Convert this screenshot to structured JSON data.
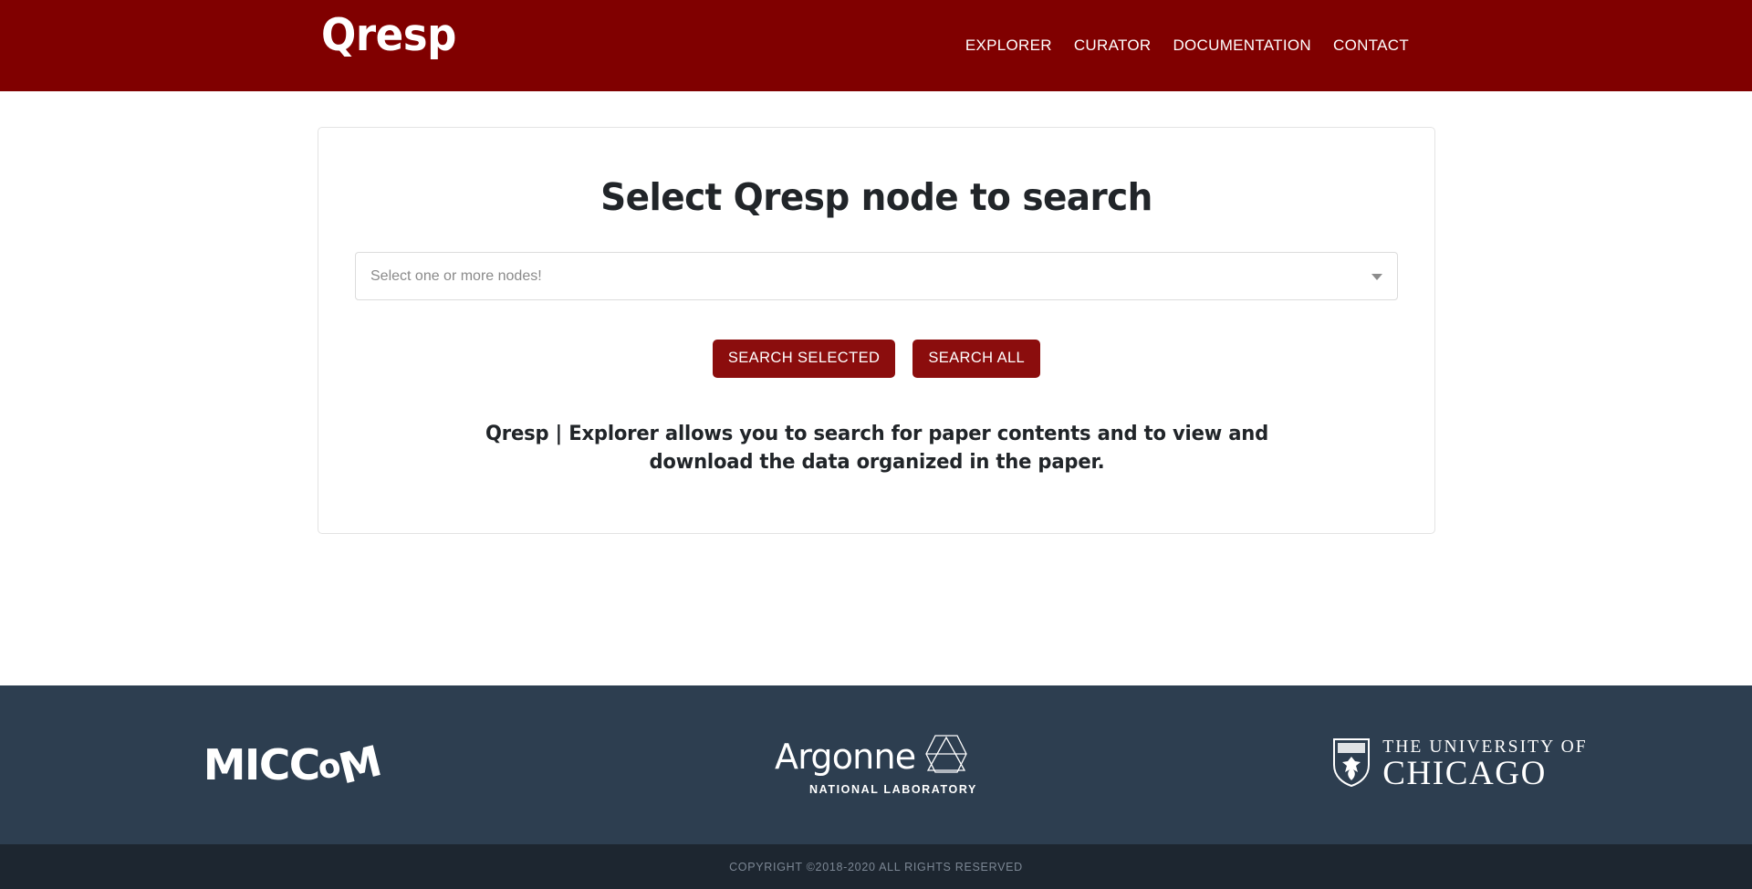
{
  "theme": {
    "header_bg": "#800000",
    "button_bg": "#8b0d0d",
    "footer_bg": "#2d3e50",
    "copyright_bg": "#1d2630",
    "text_dark": "#212529",
    "placeholder_gray": "#8a8a8a"
  },
  "header": {
    "brand": "Qresp",
    "nav": [
      {
        "label": "EXPLORER"
      },
      {
        "label": "CURATOR"
      },
      {
        "label": "DOCUMENTATION"
      },
      {
        "label": "CONTACT"
      }
    ]
  },
  "main": {
    "title": "Select Qresp node to search",
    "node_select": {
      "placeholder": "Select one or more nodes!",
      "value": "",
      "caret_icon": "chevron-down-icon"
    },
    "buttons": {
      "search_selected": "SEARCH SELECTED",
      "search_all": "SEARCH ALL"
    },
    "blurb": "Qresp | Explorer allows you to search for paper contents and to view and download the data organized in the paper."
  },
  "footer": {
    "logos": [
      {
        "name": "miccom-logo",
        "text": "MICCoM"
      },
      {
        "name": "argonne-logo",
        "word": "Argonne",
        "subtitle": "NATIONAL LABORATORY",
        "mark_icon": "argonne-hexagon-icon"
      },
      {
        "name": "university-of-chicago-logo",
        "line1": "THE UNIVERSITY OF",
        "line2": "CHICAGO",
        "mark_icon": "uchicago-shield-icon"
      }
    ],
    "copyright": "COPYRIGHT ©2018-2020 ALL RIGHTS RESERVED"
  }
}
